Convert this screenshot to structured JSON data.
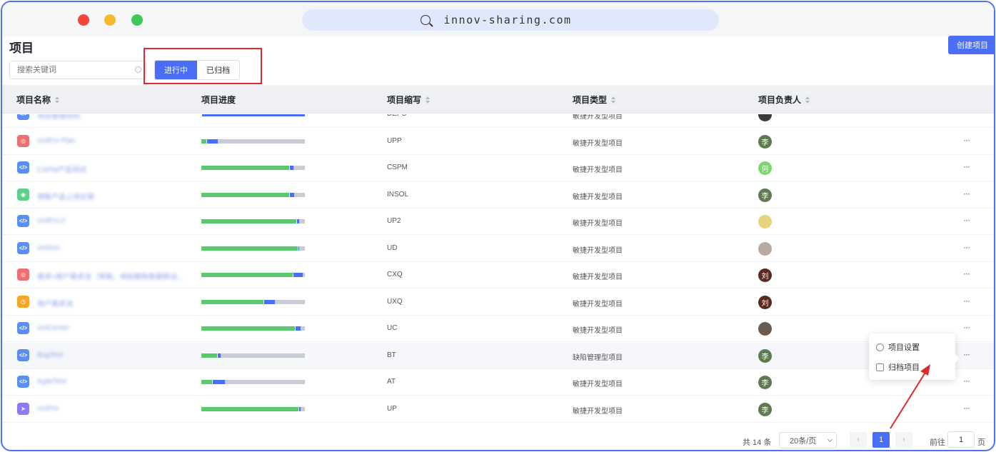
{
  "browser": {
    "url": "innov-sharing.com"
  },
  "page": {
    "title": "项目",
    "create_label": "创建项目"
  },
  "search": {
    "placeholder": "搜索关键词"
  },
  "tabs": [
    {
      "label": "进行中",
      "active": true
    },
    {
      "label": "已归档",
      "active": false
    }
  ],
  "table": {
    "headers": {
      "name": "项目名称",
      "progress": "项目进度",
      "abbr": "项目缩写",
      "type": "项目类型",
      "owner": "项目负责人"
    },
    "rows": [
      {
        "name": "项目管理协同",
        "icon": "code-icon",
        "icon_color": "#5b8ef5",
        "progress": [
          0,
          100
        ],
        "abbr": "DEPU",
        "type": "敏捷开发型项目",
        "avatar": "",
        "avatar_color": "#3a3a3a",
        "more": "···"
      },
      {
        "name": "UniPro Plan",
        "icon": "target-icon",
        "icon_color": "#ee6f6f",
        "progress": [
          5,
          10
        ],
        "abbr": "UPP",
        "type": "敏捷开发型项目",
        "avatar": "李",
        "avatar_color": "#5e7a4e",
        "more": "···"
      },
      {
        "name": "CSPM产品测试",
        "icon": "code-icon",
        "icon_color": "#5b8ef5",
        "progress": [
          85,
          3
        ],
        "abbr": "CSPM",
        "type": "敏捷开发型项目",
        "avatar": "何",
        "avatar_color": "#7ed66f",
        "more": "···"
      },
      {
        "name": "销售产品上线记录",
        "icon": "gear-icon",
        "icon_color": "#5cd18a",
        "progress": [
          85,
          4
        ],
        "abbr": "INSOL",
        "type": "敏捷开发型项目",
        "avatar": "李",
        "avatar_color": "#5e7a4e",
        "more": "···"
      },
      {
        "name": "UniPro-2",
        "icon": "code-icon",
        "icon_color": "#5b8ef5",
        "progress": [
          92,
          2
        ],
        "abbr": "UP2",
        "type": "敏捷开发型项目",
        "avatar": "",
        "avatar_color": "#e8d27a",
        "more": "···"
      },
      {
        "name": "UniDoc",
        "icon": "code-icon",
        "icon_color": "#5b8ef5",
        "progress": [
          93,
          1
        ],
        "abbr": "UD",
        "type": "敏捷开发型项目",
        "avatar": "",
        "avatar_color": "#b9aaa0",
        "more": "···"
      },
      {
        "name": "需求+用户需求池（草稿，待前期有数据移动...",
        "icon": "target-icon",
        "icon_color": "#ee6f6f",
        "progress": [
          88,
          9
        ],
        "abbr": "CXQ",
        "type": "敏捷开发型项目",
        "avatar": "刘",
        "avatar_color": "#5a2a1e",
        "more": "···"
      },
      {
        "name": "用户需求池",
        "icon": "clock-icon",
        "icon_color": "#f5a623",
        "progress": [
          60,
          10
        ],
        "abbr": "UXQ",
        "type": "敏捷开发型项目",
        "avatar": "刘",
        "avatar_color": "#5a2a1e",
        "more": "···"
      },
      {
        "name": "UniCenter",
        "icon": "code-icon",
        "icon_color": "#5b8ef5",
        "progress": [
          90,
          5
        ],
        "abbr": "UC",
        "type": "敏捷开发型项目",
        "avatar": "",
        "avatar_color": "#6b5a4e",
        "more": "···"
      },
      {
        "name": "BugTest",
        "icon": "code-icon",
        "icon_color": "#5b8ef5",
        "progress": [
          15,
          3
        ],
        "abbr": "BT",
        "type": "缺陷管理型项目",
        "avatar": "李",
        "avatar_color": "#5e7a4e",
        "more": "···"
      },
      {
        "name": "AgileTest",
        "icon": "code-icon",
        "icon_color": "#5b8ef5",
        "progress": [
          10,
          12
        ],
        "abbr": "AT",
        "type": "敏捷开发型项目",
        "avatar": "李",
        "avatar_color": "#5e7a4e",
        "more": "···"
      },
      {
        "name": "UniPro",
        "icon": "send-icon",
        "icon_color": "#8b7df0",
        "progress": [
          94,
          1
        ],
        "abbr": "UP",
        "type": "敏捷开发型项目",
        "avatar": "李",
        "avatar_color": "#5e7a4e",
        "more": "···"
      }
    ]
  },
  "context_menu": {
    "items": [
      {
        "label": "项目设置",
        "icon": "settings-icon"
      },
      {
        "label": "归档项目",
        "icon": "archive-icon"
      }
    ]
  },
  "pagination": {
    "total": "共 14 条",
    "page_size": "20条/页",
    "current": "1",
    "goto_label": "前往",
    "goto_value": "1",
    "goto_suffix": "页"
  },
  "colors": {
    "accent": "#4a6ef5",
    "progress_done": "#5ac86c",
    "progress_active": "#4a6ef5",
    "highlight_box": "#e0282e"
  }
}
